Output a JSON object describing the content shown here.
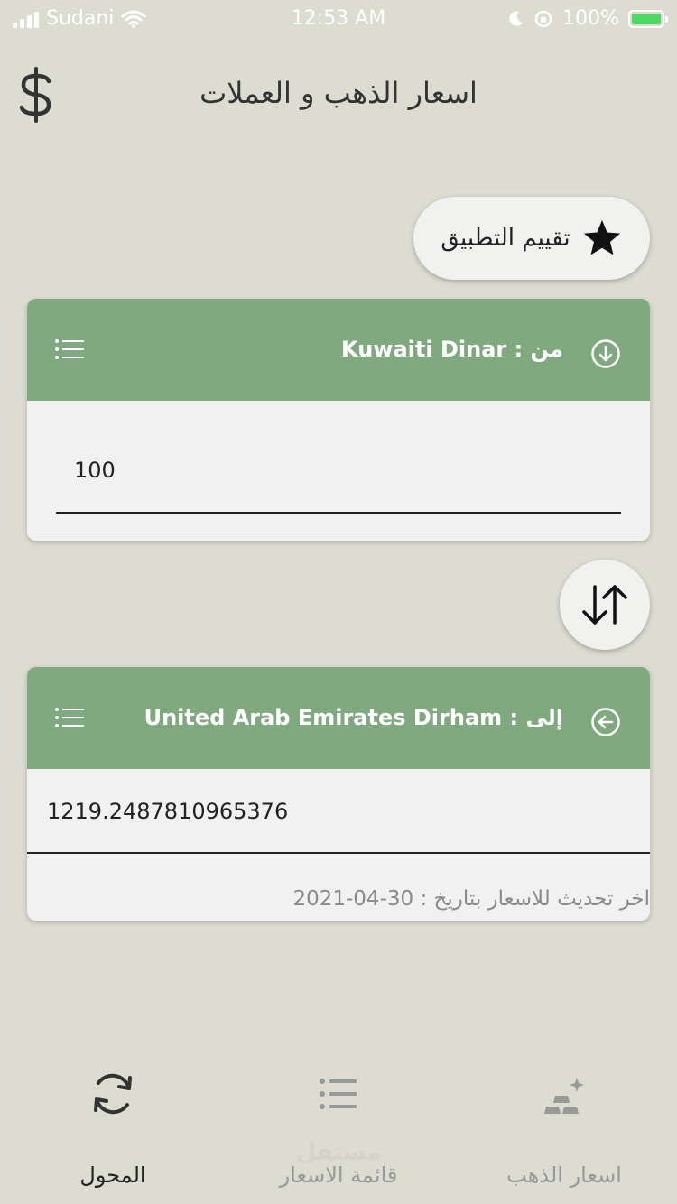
{
  "status_bar": {
    "carrier": "Sudani",
    "time": "12:53 AM",
    "battery": "100%"
  },
  "header": {
    "title": "اسعار الذهب و العملات"
  },
  "rate_button": {
    "label": "تقييم التطبيق"
  },
  "from_card": {
    "title": "من : Kuwaiti Dinar",
    "amount": "100"
  },
  "to_card": {
    "title": "إلى : United Arab Emirates Dirham",
    "amount": "1219.2487810965376",
    "update_note": "اخر تحديث للاسعار بتاريخ : 30-04-2021"
  },
  "bottom_nav": {
    "items": [
      {
        "label": "المحول",
        "icon": "refresh-icon",
        "active": true
      },
      {
        "label": "قائمة الاسعار",
        "icon": "list-icon",
        "active": false
      },
      {
        "label": "اسعار الذهب",
        "icon": "gold-bars-icon",
        "active": false
      }
    ]
  },
  "watermark": "مستقل",
  "colors": {
    "background": "#dcdcd1",
    "card_header": "#80a980",
    "card_body": "#f1f1f1"
  }
}
